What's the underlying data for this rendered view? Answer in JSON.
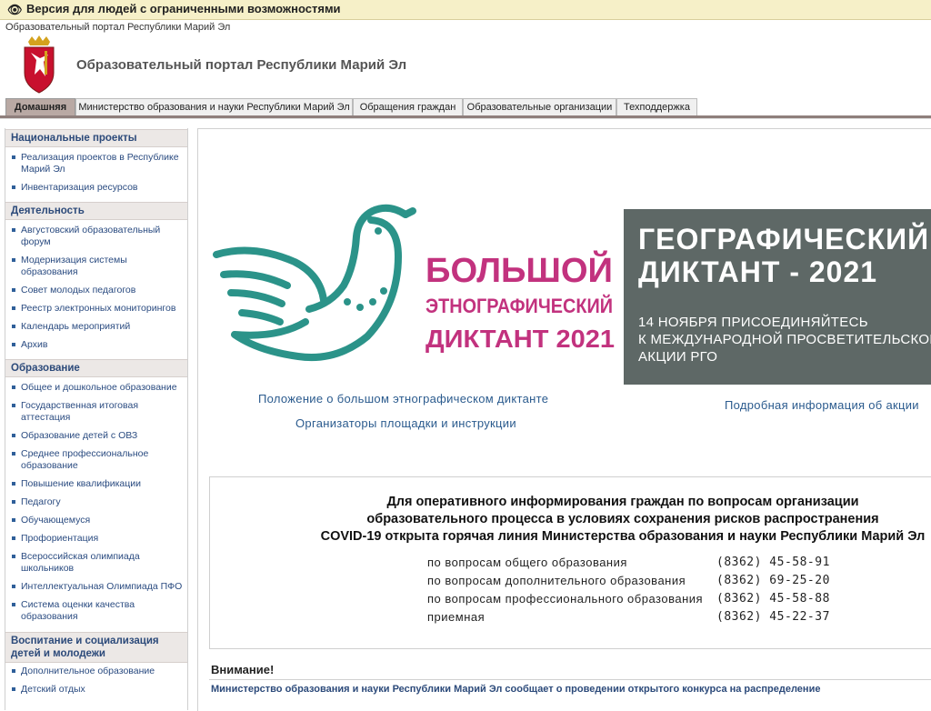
{
  "accessibility_bar": {
    "icon": "eye-icon",
    "label": "Версия для людей с ограниченными возможностями"
  },
  "header": {
    "site_name": "Образовательный портал Республики Марий Эл",
    "title": "Образовательный портал Республики Марий Эл"
  },
  "tabs": [
    {
      "label": "Домашняя",
      "active": true
    },
    {
      "label": "Министерство образования и науки Республики Марий Эл"
    },
    {
      "label": "Обращения граждан"
    },
    {
      "label": "Образовательные организации"
    },
    {
      "label": "Техподдержка"
    }
  ],
  "sidebar": {
    "sections": [
      {
        "title": "Национальные проекты",
        "items": [
          "Реализация проектов в Республике Марий Эл",
          "Инвентаризация ресурсов"
        ]
      },
      {
        "title": "Деятельность",
        "items": [
          "Августовский образовательный форум",
          "Модернизация системы образования",
          "Совет молодых педагогов",
          "Реестр электронных мониторингов",
          "Календарь мероприятий",
          "Архив"
        ]
      },
      {
        "title": "Образование",
        "items": [
          "Общее и дошкольное образование",
          "Государственная итоговая аттестация",
          "Образование детей с ОВЗ",
          "Среднее профессиональное образование",
          "Повышение квалификации",
          "Педагогу",
          "Обучающемуся",
          "Профориентация",
          "Всероссийская олимпиада школьников",
          "Интеллектуальная Олимпиада ПФО",
          "Система оценки качества образования"
        ]
      },
      {
        "title": "Воспитание и социализация детей и молодежи",
        "items": [
          "Дополнительное образование",
          "Детский отдых"
        ]
      }
    ]
  },
  "banners": {
    "ethno": {
      "line1": "БОЛЬШОЙ",
      "line2": "ЭТНОГРАФИЧЕСКИЙ",
      "line3": "ДИКТАНТ 2021"
    },
    "geo": {
      "line1": "ГЕОГРАФИЧЕСКИЙ",
      "line2": "ДИКТАНТ - 2021",
      "sub1": "14 НОЯБРЯ ПРИСОЕДИНЯЙТЕСЬ",
      "sub2": "К МЕЖДУНАРОДНОЙ ПРОСВЕТИТЕЛЬСКОЙ",
      "sub3": "АКЦИИ РГО"
    }
  },
  "links": {
    "ethno_regulation": "Положение о  большом этнографическом диктанте",
    "ethno_organizers": "Организаторы площадки и инструкции",
    "geo_more": "Подробная информация об акции"
  },
  "hotline": {
    "title_lines": [
      "Для оперативного информирования граждан по вопросам организации",
      "образовательного процесса в условиях сохранения рисков распространения",
      "COVID-19 открыта горячая линия Министерства образования и науки Республики Марий Эл"
    ],
    "phones": [
      {
        "label": "по вопросам общего образования",
        "number": "(8362) 45-58-91"
      },
      {
        "label": "по вопросам дополнительного образования",
        "number": "(8362) 69-25-20"
      },
      {
        "label": "по вопросам профессионального образования",
        "number": "(8362) 45-58-88"
      },
      {
        "label": "приемная",
        "number": "(8362) 45-22-37"
      }
    ]
  },
  "attention": {
    "heading": "Внимание!",
    "news": "Министерство образования и науки Республики Марий Эл сообщает о проведении открытого конкурса на распределение"
  },
  "colors": {
    "accent": "#2b5b8e",
    "ethno_pink": "#c2327e",
    "ethno_teal": "#2b9389",
    "tab_active": "#b9a9a4"
  }
}
